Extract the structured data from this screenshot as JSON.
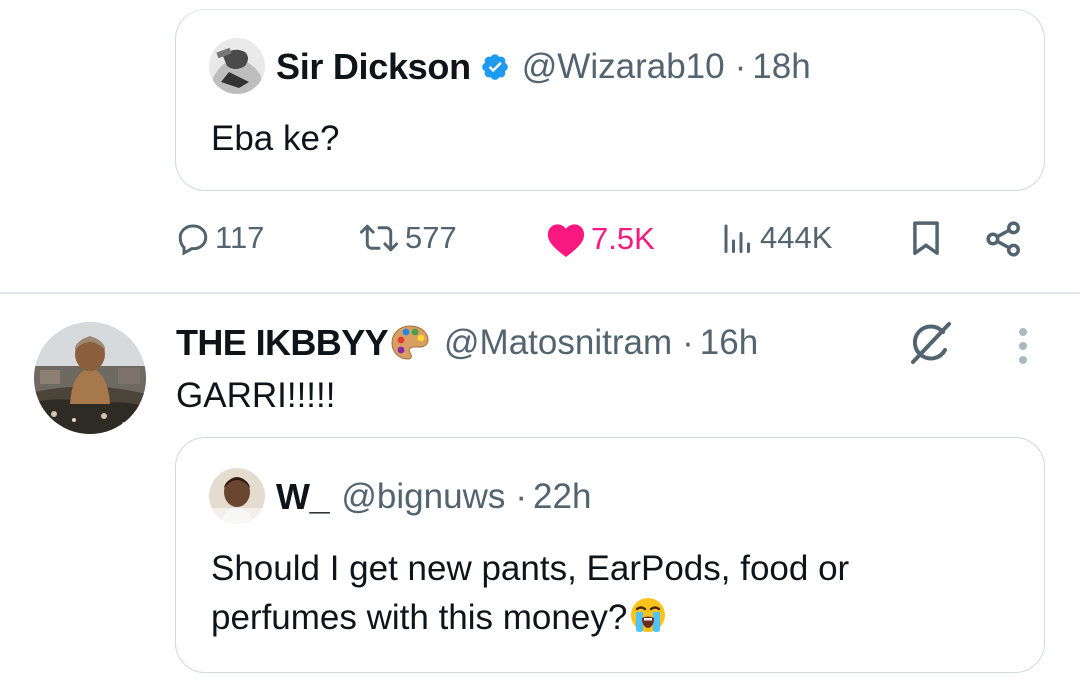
{
  "quoted_tweet_1": {
    "name": "Sir Dickson",
    "handle": "@Wizarab10",
    "separator": "·",
    "time": "18h",
    "text": "Eba ke?",
    "verified": true
  },
  "actions": {
    "replies": "117",
    "reposts": "577",
    "likes": "7.5K",
    "views": "444K",
    "like_color": "#f91880"
  },
  "reply_tweet": {
    "name": "THE IKBBYY",
    "name_emoji": "palette-emoji",
    "handle": "@Matosnitram",
    "separator": "·",
    "time": "16h",
    "text": "GARRI!!!!!"
  },
  "quoted_tweet_2": {
    "name": "W_",
    "handle": "@bignuws",
    "separator": "·",
    "time": "22h",
    "text": "Should I get new pants, EarPods, food or perfumes with this money?",
    "trailing_emoji": "loudly-crying-face-emoji"
  },
  "colors": {
    "text_primary": "#0f1419",
    "text_secondary": "#536471",
    "verified_blue": "#1d9bf0",
    "border": "#cfd9de"
  }
}
